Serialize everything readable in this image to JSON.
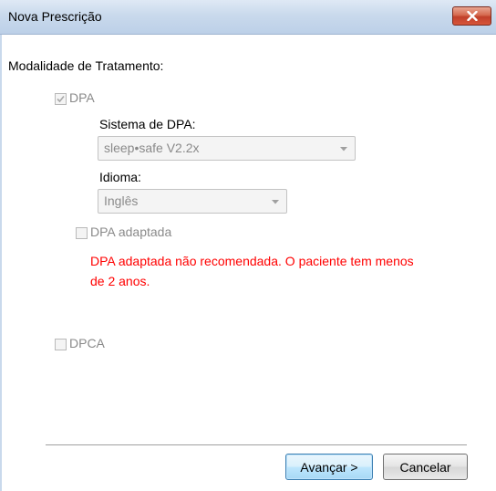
{
  "window": {
    "title": "Nova Prescrição"
  },
  "form": {
    "section_label": "Modalidade de Tratamento:",
    "dpa": {
      "label": "DPA",
      "checked": true,
      "enabled": false
    },
    "sistema": {
      "label": "Sistema de DPA:",
      "value": "sleep•safe V2.2x"
    },
    "idioma": {
      "label": "Idioma:",
      "value": "Inglês"
    },
    "dpa_adaptada": {
      "label": "DPA adaptada",
      "checked": false,
      "enabled": false
    },
    "warning_line1": "DPA adaptada não recomendada. O paciente tem menos",
    "warning_line2": "de 2 anos.",
    "dpca": {
      "label": "DPCA",
      "checked": false,
      "enabled": false
    }
  },
  "buttons": {
    "next": "Avançar >",
    "cancel": "Cancelar"
  },
  "colors": {
    "warning": "#ff0000",
    "disabled_text": "#8a8a8a",
    "titlebar": "#c9d9ec"
  }
}
